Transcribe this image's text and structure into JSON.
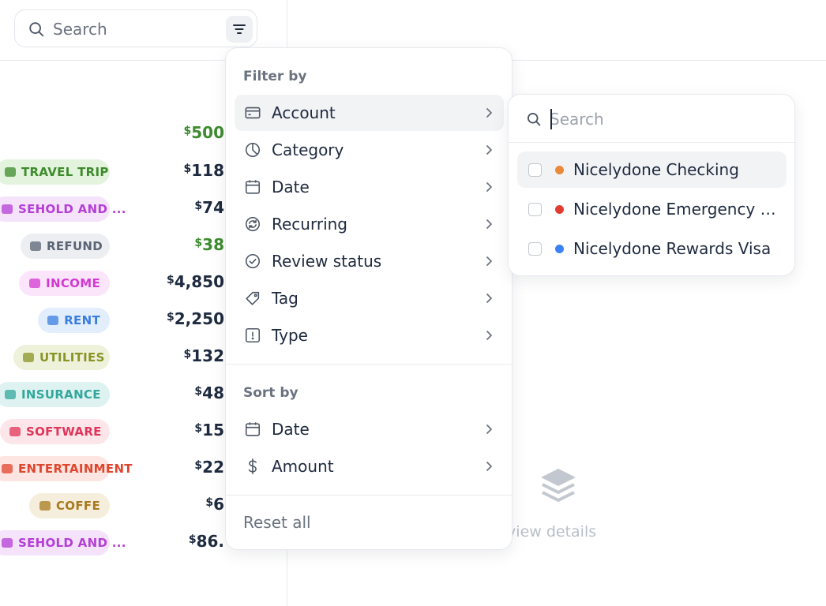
{
  "search": {
    "placeholder": "Search"
  },
  "transactions": [
    {
      "category": "",
      "amount": "500",
      "amount_color": "green"
    },
    {
      "category": "TRAVEL TRIP",
      "amount": "118",
      "amount_color": "dark",
      "chip_bg": "#e3f3de",
      "chip_fg": "#3e8b2b"
    },
    {
      "category": "SEHOLD AND ...",
      "amount": "74",
      "amount_color": "dark",
      "chip_bg": "#f5e3fb",
      "chip_fg": "#b43ed6"
    },
    {
      "category": "REFUND",
      "amount": "38",
      "amount_color": "green",
      "chip_bg": "#eceef1",
      "chip_fg": "#5b6474"
    },
    {
      "category": "INCOME",
      "amount": "4,850",
      "amount_color": "dark",
      "chip_bg": "#fbe5fb",
      "chip_fg": "#d13ad0"
    },
    {
      "category": "RENT",
      "amount": "2,250",
      "amount_color": "dark",
      "chip_bg": "#e3eefc",
      "chip_fg": "#3b7de3"
    },
    {
      "category": "UTILITIES",
      "amount": "132",
      "amount_color": "dark",
      "chip_bg": "#eef2db",
      "chip_fg": "#8a9325"
    },
    {
      "category": "INSURANCE",
      "amount": "48",
      "amount_color": "dark",
      "chip_bg": "#def3f1",
      "chip_fg": "#33a79c"
    },
    {
      "category": "SOFTWARE",
      "amount": "15",
      "amount_color": "dark",
      "chip_bg": "#fde6ea",
      "chip_fg": "#e0355a"
    },
    {
      "category": "ENTERTAINMENT",
      "amount": "22",
      "amount_color": "dark",
      "chip_bg": "#fde5e1",
      "chip_fg": "#e0452d"
    },
    {
      "category": "COFFE",
      "amount": "6",
      "amount_color": "dark",
      "chip_bg": "#f6eedc",
      "chip_fg": "#a87a1f"
    },
    {
      "category": "SEHOLD AND ...",
      "amount": "86.",
      "amount_color": "dark",
      "chip_bg": "#f5e3fb",
      "chip_fg": "#b43ed6"
    }
  ],
  "currency_symbol": "$",
  "filter_menu": {
    "filter_label": "Filter by",
    "filter_items": [
      {
        "label": "Account",
        "icon": "credit-card-icon"
      },
      {
        "label": "Category",
        "icon": "pie-chart-icon"
      },
      {
        "label": "Date",
        "icon": "calendar-icon"
      },
      {
        "label": "Recurring",
        "icon": "recurring-icon"
      },
      {
        "label": "Review status",
        "icon": "check-circle-icon"
      },
      {
        "label": "Tag",
        "icon": "tag-icon"
      },
      {
        "label": "Type",
        "icon": "type-icon"
      }
    ],
    "sort_label": "Sort by",
    "sort_items": [
      {
        "label": "Date",
        "icon": "calendar-icon"
      },
      {
        "label": "Amount",
        "icon": "dollar-icon"
      }
    ],
    "reset_label": "Reset all"
  },
  "account_submenu": {
    "search_placeholder": "Search",
    "accounts": [
      {
        "label": "Nicelydone Checking",
        "dot_color": "#e88a3a"
      },
      {
        "label": "Nicelydone Emergency S...",
        "dot_color": "#e23b2f"
      },
      {
        "label": "Nicelydone Rewards Visa",
        "dot_color": "#3b82f6"
      }
    ]
  },
  "empty_state": {
    "text": "ct to view details"
  }
}
